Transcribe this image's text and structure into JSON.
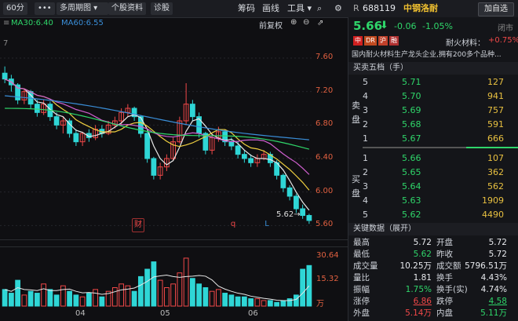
{
  "toolbar": {
    "period": "60分",
    "more": "•••",
    "multi_period": "多周期图 ▾",
    "profile": "个股资料",
    "diagnose": "诊股",
    "code": "筹码",
    "draw": "画线",
    "tools": "工具",
    "add_watch": "加自选"
  },
  "indicators": {
    "ma30": "MA30:6.40",
    "ma60": "MA60:6.55",
    "right_menu": "前复权"
  },
  "axis": {
    "price_ticks": [
      "7.60",
      "7.20",
      "6.80",
      "6.40",
      "6.00",
      "5.60"
    ],
    "volume_ticks": [
      "30.64",
      "15.32",
      "万"
    ],
    "months": [
      "04",
      "05",
      "06"
    ],
    "low_marker": "5.62→",
    "left_fragment": "7"
  },
  "markers": {
    "cai": "财",
    "q": "q",
    "l": "L"
  },
  "stock": {
    "prefix": "R",
    "code": "688119",
    "name": "中钢洛耐",
    "price": "5.66",
    "change": "-0.06",
    "change_pct": "-1.05%",
    "status": "闭市",
    "tags": [
      "中",
      "DR",
      "沪",
      "融"
    ],
    "sector": "耐火材料：",
    "sector_pct": "+0.75%",
    "description": "国内耐火材料生产龙头企业,拥有200多个品种..."
  },
  "order_book": {
    "title": "买卖五档（手）",
    "sell_label": [
      "卖",
      "盘"
    ],
    "buy_label": [
      "买",
      "盘"
    ],
    "sell": [
      {
        "lvl": "5",
        "price": "5.71",
        "vol": "127"
      },
      {
        "lvl": "4",
        "price": "5.70",
        "vol": "941"
      },
      {
        "lvl": "3",
        "price": "5.69",
        "vol": "757"
      },
      {
        "lvl": "2",
        "price": "5.68",
        "vol": "591"
      },
      {
        "lvl": "1",
        "price": "5.67",
        "vol": "666"
      }
    ],
    "buy": [
      {
        "lvl": "1",
        "price": "5.66",
        "vol": "107"
      },
      {
        "lvl": "2",
        "price": "5.65",
        "vol": "362"
      },
      {
        "lvl": "3",
        "price": "5.64",
        "vol": "562"
      },
      {
        "lvl": "4",
        "price": "5.63",
        "vol": "1909"
      },
      {
        "lvl": "5",
        "price": "5.62",
        "vol": "4490"
      }
    ]
  },
  "key_data": {
    "title": "关键数据（展开）",
    "rows": [
      {
        "k1": "最高",
        "v1": "5.72",
        "k2": "开盘",
        "v2": "5.72"
      },
      {
        "k1": "最低",
        "v1": "5.62",
        "k2": "昨收",
        "v2": "5.72"
      },
      {
        "k1": "成交量",
        "v1": "10.25万",
        "k2": "成交额",
        "v2": "5796.51万"
      },
      {
        "k1": "量比",
        "v1": "1.81",
        "k2": "换手",
        "v2": "4.43%"
      },
      {
        "k1": "振幅",
        "v1": "1.75%",
        "k2": "换手(实)",
        "v2": "4.74%"
      },
      {
        "k1": "涨停",
        "v1": "6.86",
        "k2": "跌停",
        "v2": "4.58"
      },
      {
        "k1": "外盘",
        "v1": "5.14万",
        "k2": "内盘",
        "v2": "5.11万"
      }
    ]
  },
  "colors": {
    "up": "#f04848",
    "down": "#2fd6d6",
    "ma5": "#e8e8e8",
    "ma10": "#f0d040",
    "ma20": "#d060d0",
    "ma30": "#2fd66a",
    "ma60": "#3a8ed8"
  },
  "chart_data": {
    "type": "candlestick",
    "ylim": [
      5.5,
      7.75
    ],
    "candles": [
      [
        7.42,
        7.35,
        7.5,
        7.3
      ],
      [
        7.35,
        7.28,
        7.4,
        7.2
      ],
      [
        7.28,
        7.1,
        7.3,
        7.05
      ],
      [
        7.1,
        7.2,
        7.24,
        7.05
      ],
      [
        7.2,
        7.05,
        7.22,
        7.0
      ],
      [
        7.05,
        6.95,
        7.1,
        6.9
      ],
      [
        6.95,
        7.05,
        7.1,
        6.92
      ],
      [
        7.05,
        6.9,
        7.08,
        6.85
      ],
      [
        6.9,
        6.8,
        6.95,
        6.75
      ],
      [
        6.8,
        6.85,
        6.9,
        6.7
      ],
      [
        6.85,
        6.7,
        6.88,
        6.65
      ],
      [
        6.7,
        6.6,
        6.75,
        6.55
      ],
      [
        6.6,
        6.7,
        6.72,
        6.55
      ],
      [
        6.7,
        6.65,
        6.75,
        6.6
      ],
      [
        6.65,
        6.75,
        6.8,
        6.62
      ],
      [
        6.75,
        6.7,
        6.8,
        6.65
      ],
      [
        6.7,
        6.8,
        6.85,
        6.68
      ],
      [
        6.8,
        6.85,
        6.9,
        6.76
      ],
      [
        6.85,
        6.95,
        7.0,
        6.8
      ],
      [
        6.95,
        7.0,
        7.05,
        6.9
      ],
      [
        7.0,
        6.9,
        7.02,
        6.85
      ],
      [
        6.9,
        6.7,
        6.92,
        6.65
      ],
      [
        6.7,
        6.4,
        6.72,
        6.35
      ],
      [
        6.4,
        6.2,
        6.42,
        6.15
      ],
      [
        6.2,
        6.3,
        6.35,
        6.15
      ],
      [
        6.3,
        6.4,
        6.45,
        6.25
      ],
      [
        6.4,
        6.6,
        6.65,
        6.38
      ],
      [
        6.6,
        6.85,
        6.9,
        6.58
      ],
      [
        6.85,
        7.05,
        7.3,
        6.8
      ],
      [
        7.05,
        6.9,
        7.1,
        6.85
      ],
      [
        6.9,
        6.7,
        6.95,
        6.65
      ],
      [
        6.7,
        6.5,
        6.72,
        6.45
      ],
      [
        6.5,
        6.65,
        6.7,
        6.45
      ],
      [
        6.65,
        6.72,
        6.78,
        6.6
      ],
      [
        6.72,
        6.6,
        6.75,
        6.55
      ],
      [
        6.6,
        6.55,
        6.65,
        6.5
      ],
      [
        6.55,
        6.45,
        6.6,
        6.4
      ],
      [
        6.45,
        6.4,
        6.5,
        6.35
      ],
      [
        6.4,
        6.35,
        6.45,
        6.3
      ],
      [
        6.35,
        6.4,
        6.45,
        6.3
      ],
      [
        6.4,
        6.45,
        6.5,
        6.38
      ],
      [
        6.45,
        6.35,
        6.48,
        6.3
      ],
      [
        6.35,
        6.2,
        6.38,
        6.15
      ],
      [
        6.2,
        6.05,
        6.22,
        6.0
      ],
      [
        6.05,
        5.95,
        6.08,
        5.9
      ],
      [
        5.95,
        5.8,
        5.98,
        5.75
      ],
      [
        5.8,
        5.72,
        5.85,
        5.68
      ],
      [
        5.72,
        5.66,
        5.74,
        5.62
      ]
    ],
    "volume": [
      9,
      7,
      14,
      6,
      8,
      7,
      12,
      9,
      6,
      11,
      8,
      6,
      5,
      7,
      9,
      5,
      8,
      10,
      12,
      11,
      8,
      16,
      20,
      24,
      14,
      10,
      12,
      18,
      26,
      15,
      12,
      10,
      8,
      9,
      7,
      6,
      5,
      5,
      4,
      4,
      3,
      3,
      2,
      3,
      4,
      6,
      20,
      22
    ],
    "volume_max": 30.64
  }
}
